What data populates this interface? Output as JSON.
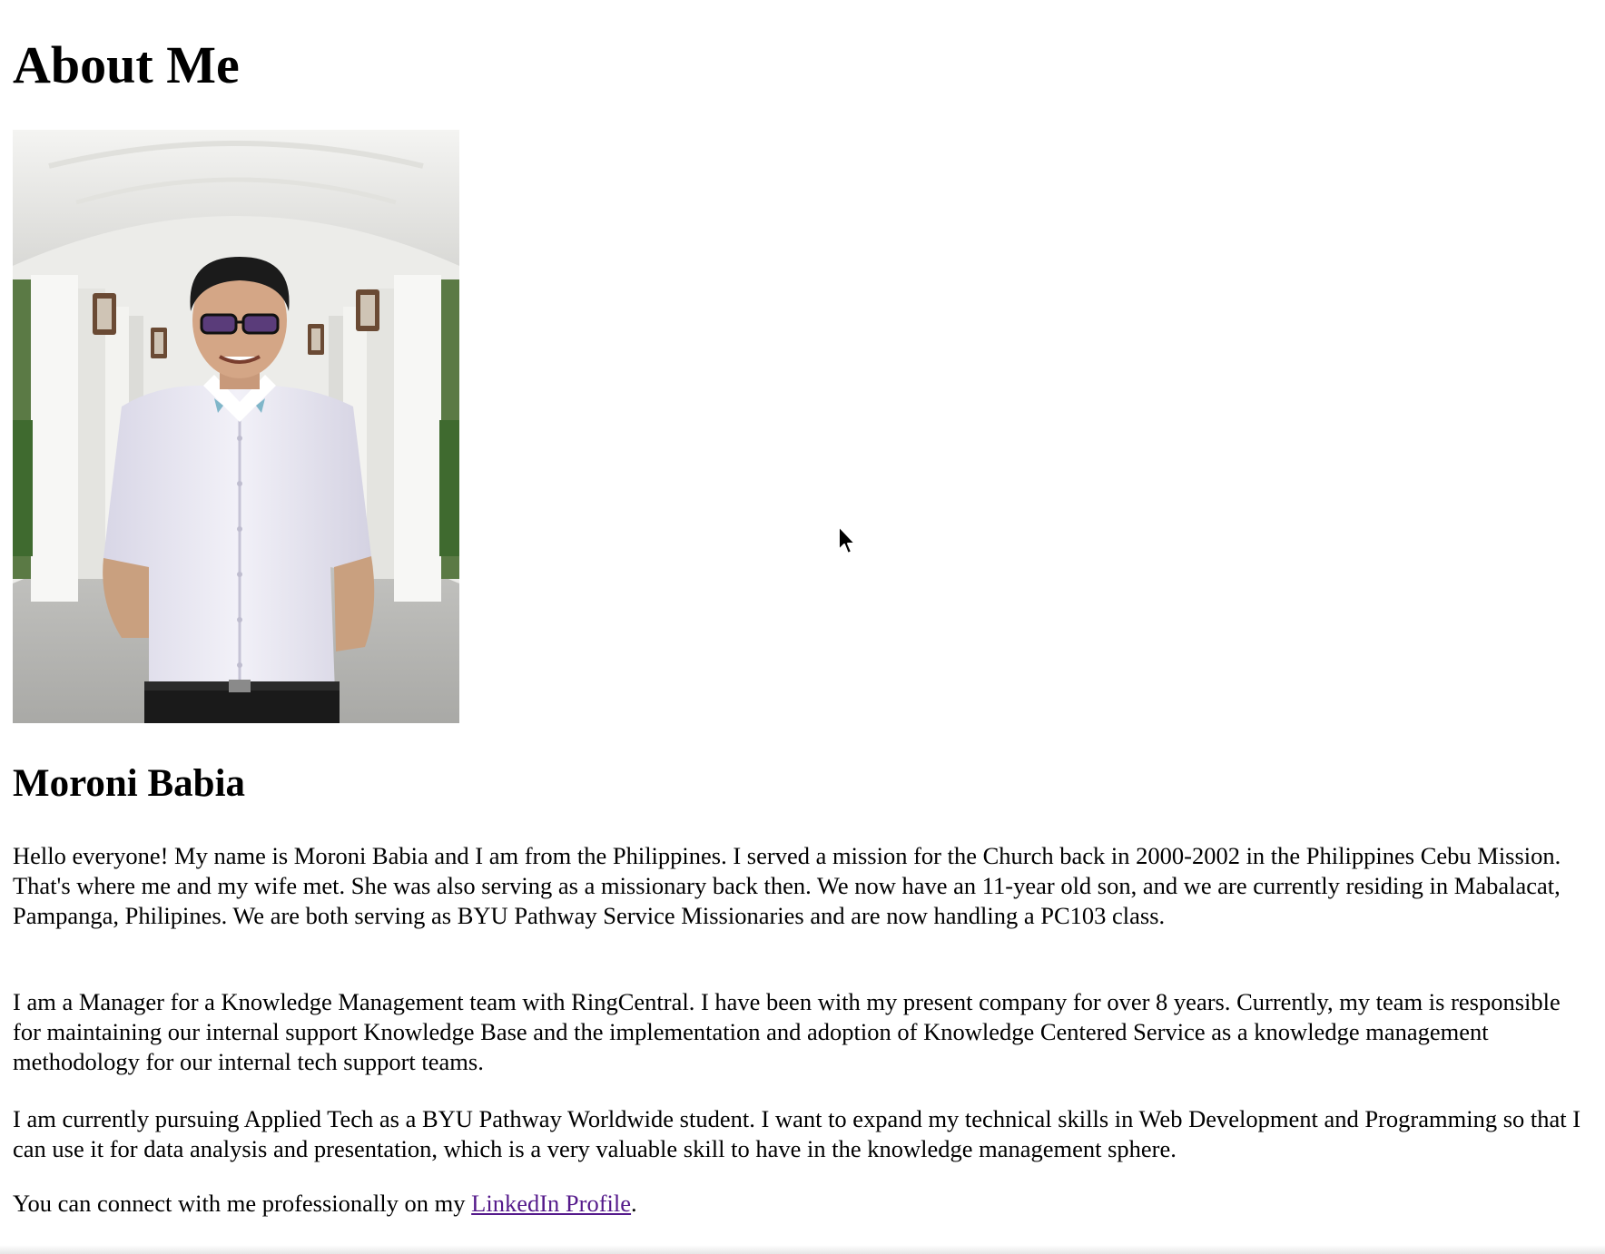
{
  "page": {
    "heading": "About Me",
    "photo_icon": "portrait-photo",
    "name": "Moroni Babia",
    "paragraphs": [
      "Hello everyone! My name is Moroni Babia and I am from the Philippines. I served a mission for the Church back in 2000-2002 in the Philippines Cebu Mission. That's where me and my wife met. She was also serving as a missionary back then. We now have an 11-year old son, and we are currently residing in Mabalacat, Pampanga, Philipines. We are both serving as BYU Pathway Service Missionaries and are now handling a PC103 class.",
      "I am a Manager for a Knowledge Management team with RingCentral. I have been with my present company for over 8 years. Currently, my team is responsible for maintaining our internal support Knowledge Base and the implementation and adoption of Knowledge Centered Service as a knowledge management methodology for our internal tech support teams.",
      "I am currently pursuing Applied Tech as a BYU Pathway Worldwide student. I want to expand my technical skills in Web Development and Programming so that I can use it for data analysis and presentation, which is a very valuable skill to have in the knowledge management sphere."
    ],
    "connect": {
      "prefix": "You can connect with me professionally on my ",
      "link_label": "LinkedIn Profile",
      "suffix": "."
    },
    "link_color": "#551a8b",
    "cursor_icon": "arrow-cursor"
  }
}
